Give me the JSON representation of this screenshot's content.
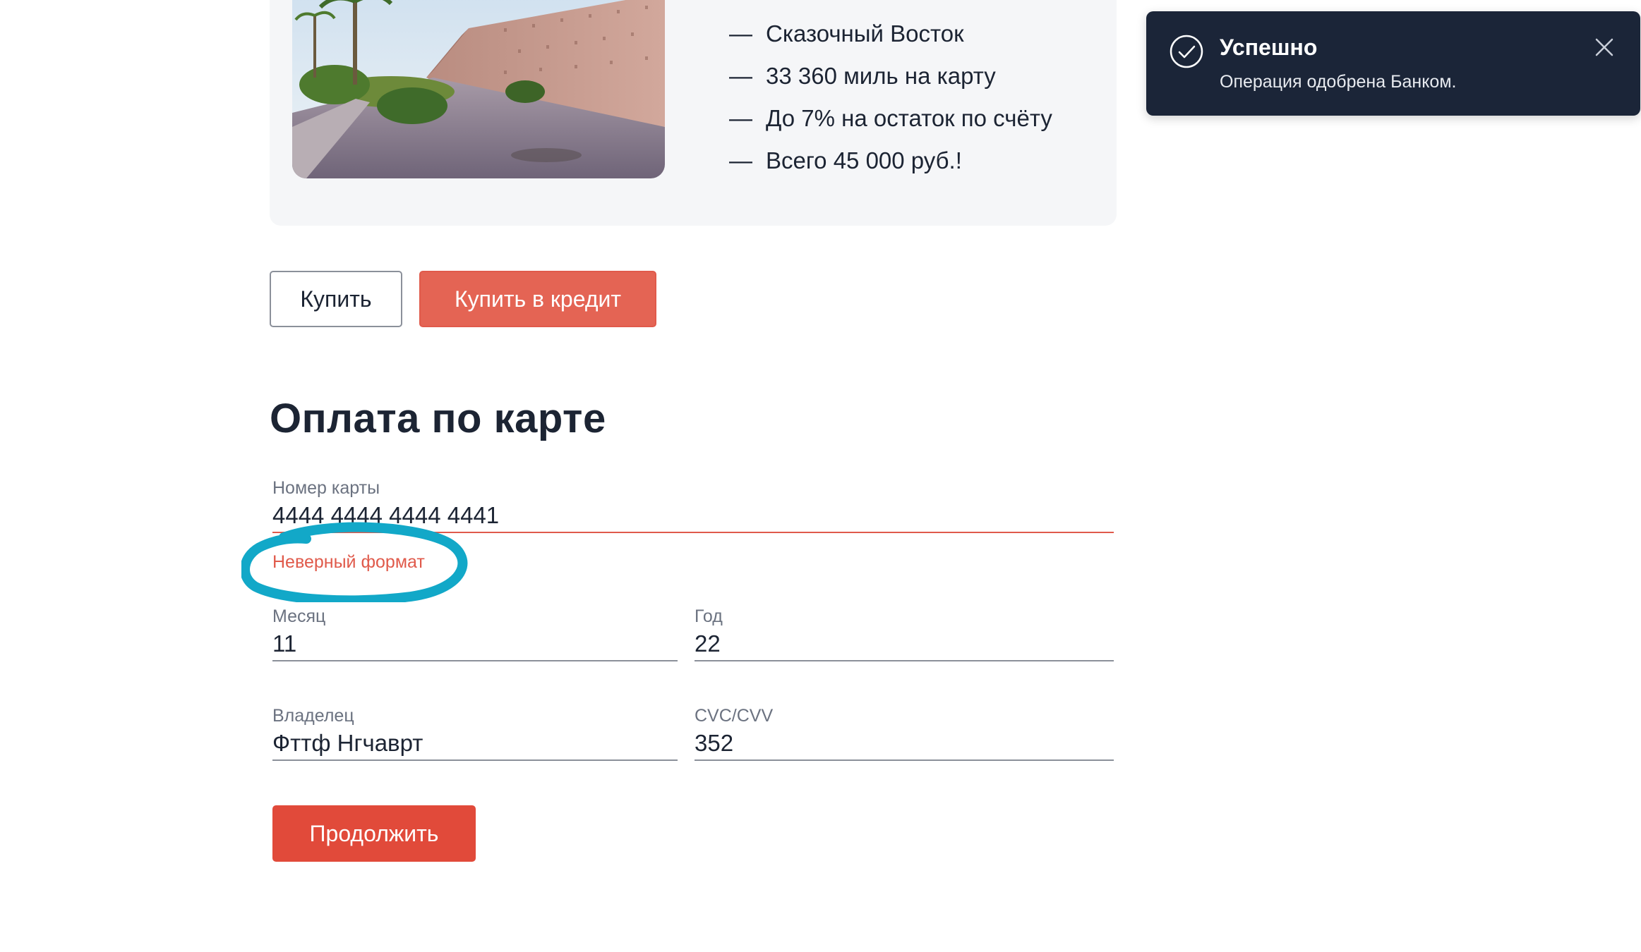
{
  "offer": {
    "features": [
      "Сказочный Восток",
      "33 360 миль на карту",
      "До 7% на остаток по счёту",
      "Всего 45 000 руб.!"
    ],
    "dash": "—"
  },
  "actions": {
    "buy_label": "Купить",
    "buy_credit_label": "Купить в кредит"
  },
  "payment": {
    "title": "Оплата по карте",
    "card_number": {
      "label": "Номер карты",
      "value": "4444 4444 4444 4441",
      "error": "Неверный формат"
    },
    "month": {
      "label": "Месяц",
      "value": "11"
    },
    "year": {
      "label": "Год",
      "value": "22"
    },
    "owner": {
      "label": "Владелец",
      "value": "Фттф Нгчаврт"
    },
    "cvc": {
      "label": "CVC/CVV",
      "value": "352"
    },
    "continue_label": "Продолжить"
  },
  "toast": {
    "title": "Успешно",
    "message": "Операция одобрена Банком.",
    "icon": "check-circle-icon",
    "close_icon": "close-icon"
  },
  "colors": {
    "accent": "#e46454",
    "continue": "#e14a3a",
    "error": "#e05a4b",
    "toast_bg": "#1b2538",
    "annotation": "#12a8c8"
  }
}
